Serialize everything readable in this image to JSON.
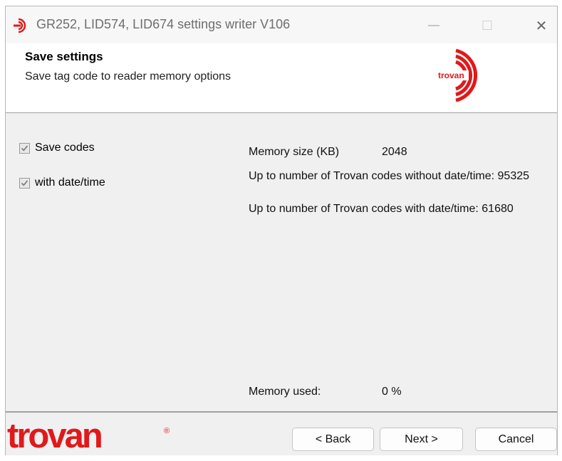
{
  "window": {
    "title": "GR252, LID574, LID674 settings writer V106",
    "controls": {
      "minimize": "—",
      "maximize": "☐",
      "close": "✕"
    },
    "icon": "trovan-app-icon"
  },
  "header": {
    "title": "Save settings",
    "subtitle": "Save tag code to reader memory options",
    "logo_text": "trovan",
    "logo_icon": "trovan-logo"
  },
  "options": {
    "save_codes": {
      "label": "Save codes",
      "checked": true
    },
    "with_date_time": {
      "label": "with date/time",
      "checked": true
    }
  },
  "memory": {
    "size_label": "Memory size (KB)",
    "size_value": "2048",
    "without_datetime": "Up to number of Trovan codes without date/time: 95325",
    "with_datetime": "Up to number of Trovan codes with date/time: 61680",
    "used_label": "Memory used:",
    "used_value": "0 %"
  },
  "footer": {
    "brand": "trovan",
    "brand_mark": "®",
    "back_label": "< Back",
    "next_label": "Next >",
    "cancel_label": "Cancel"
  },
  "colors": {
    "brand_red": "#e0191b",
    "panel_bg": "#f0f0f0",
    "header_bg": "#ffffff"
  }
}
